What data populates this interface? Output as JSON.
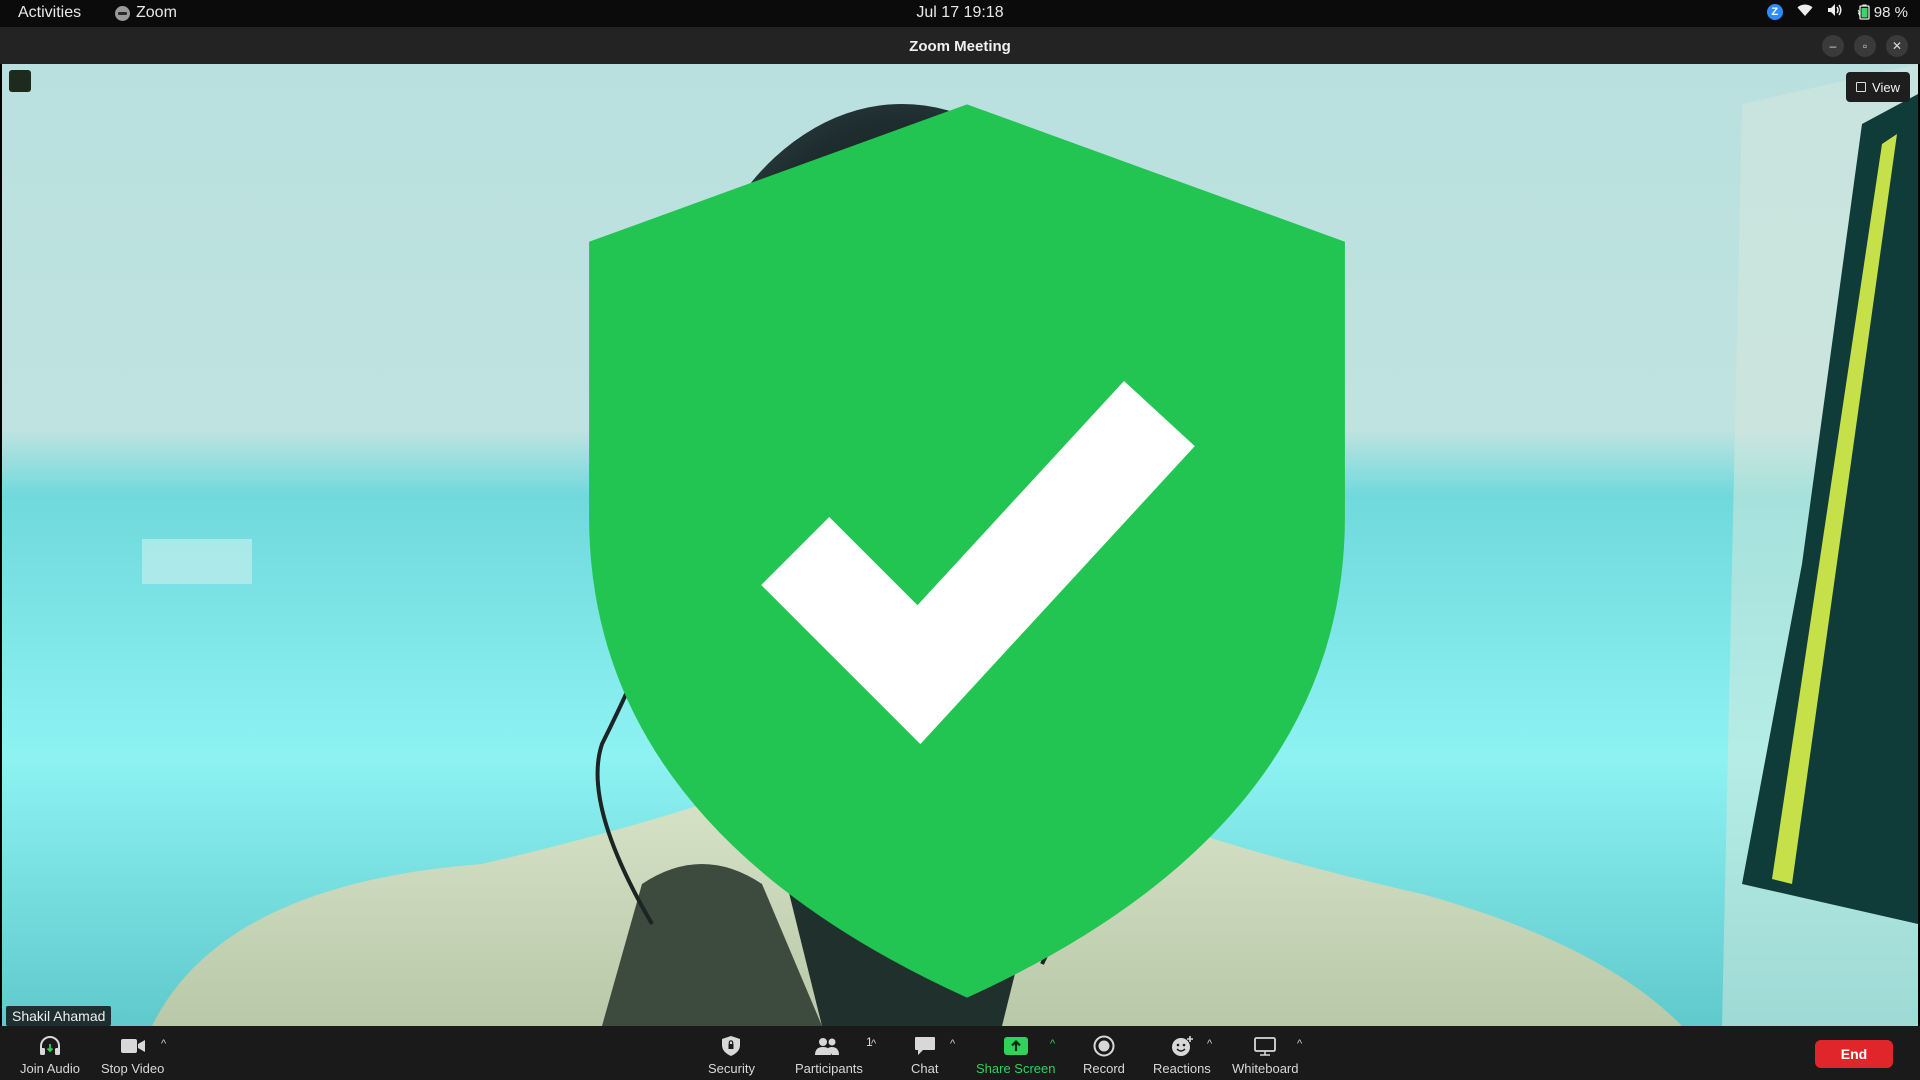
{
  "topbar": {
    "activities": "Activities",
    "app_name": "Zoom",
    "clock": "Jul 17  19:18",
    "battery": "98 %",
    "icons": [
      "zoom-tray-icon",
      "wifi-icon",
      "volume-icon",
      "battery-icon"
    ]
  },
  "window": {
    "title": "Zoom Meeting",
    "buttons": [
      "minimize-icon",
      "restore-icon",
      "close-icon"
    ]
  },
  "video": {
    "view_label": "View",
    "participant_name": "Shakil Ahamad"
  },
  "toolbar": {
    "join_audio": "Join Audio",
    "stop_video": "Stop Video",
    "security": "Security",
    "participants": "Participants",
    "participants_count": "1",
    "chat": "Chat",
    "share_screen": "Share Screen",
    "record": "Record",
    "reactions": "Reactions",
    "whiteboard": "Whiteboard",
    "end": "End"
  },
  "colors": {
    "end_button": "#e0262b",
    "share_green": "#2fd35c",
    "zoom_blue": "#2d8cff"
  }
}
